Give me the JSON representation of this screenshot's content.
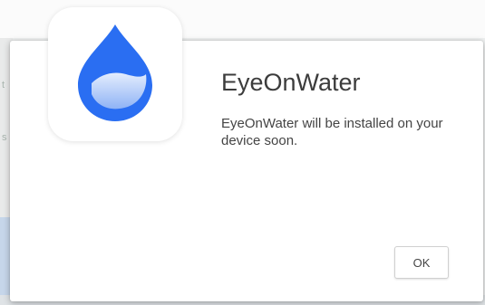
{
  "dialog": {
    "app_name": "EyeOnWater",
    "message": "EyeOnWater will be installed on your device soon.",
    "ok_label": "OK",
    "icon": "water-drop-icon"
  },
  "background": {
    "peek_text_1": "t",
    "peek_text_2": "s",
    "peek_text_3": "l"
  },
  "colors": {
    "drop_blue": "#2a6ef2",
    "drop_highlight": "#c9dcfb"
  }
}
